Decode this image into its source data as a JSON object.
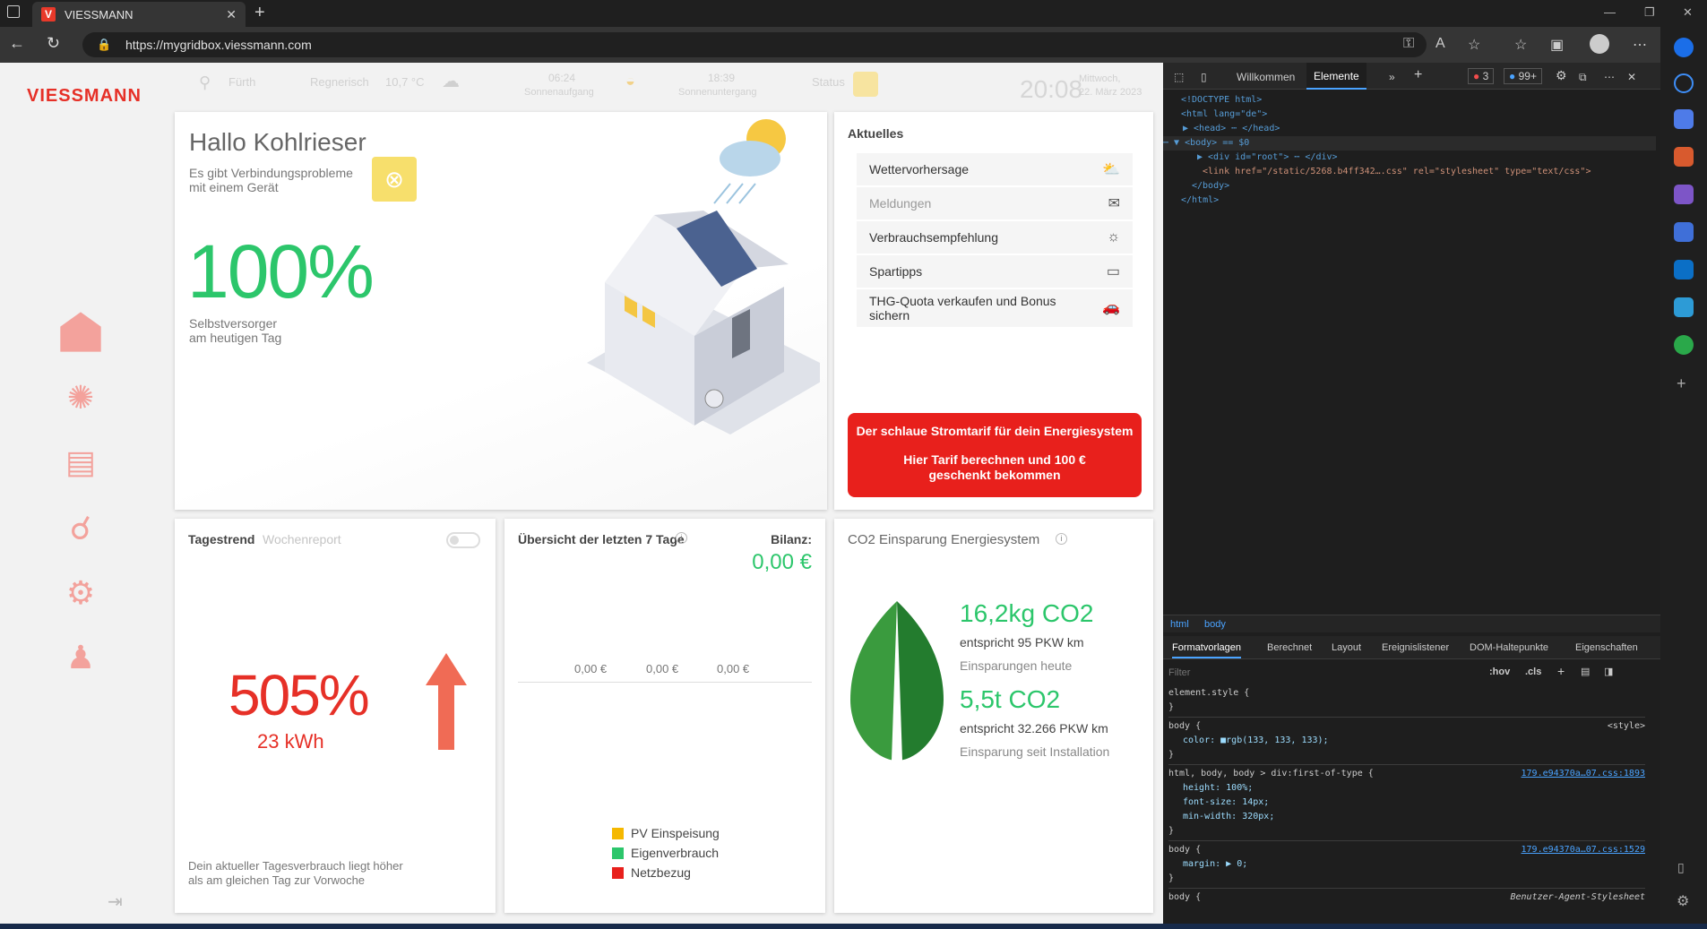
{
  "browser": {
    "tab_title": "VIESSMANN",
    "url": "https://mygridbox.viessmann.com"
  },
  "header": {
    "logo": "VIESSMANN",
    "location": "Fürth",
    "weather": "Regnerisch",
    "temperature": "10,7 °C",
    "sunrise_time": "06:24",
    "sunrise_label": "Sonnenaufgang",
    "sunset_time": "18:39",
    "sunset_label": "Sonnenuntergang",
    "status_label": "Status",
    "clock": "20:08",
    "date_line1": "Mittwoch,",
    "date_line2": "22. März 2023"
  },
  "hero": {
    "greeting": "Hallo Kohlrieser",
    "warning": "Es gibt Verbindungsprobleme mit einem Gerät",
    "percent": "100%",
    "percent_caption1": "Selbstversorger",
    "percent_caption2": "am heutigen Tag"
  },
  "aktuelles": {
    "title": "Aktuelles",
    "items": [
      {
        "label": "Wettervorhersage",
        "icon": "weather-icon"
      },
      {
        "label": "Meldungen",
        "icon": "mail-icon"
      },
      {
        "label": "Verbrauchsempfehlung",
        "icon": "bulb-icon"
      },
      {
        "label": "Spartipps",
        "icon": "money-icon"
      },
      {
        "label": "THG-Quota verkaufen und Bonus sichern",
        "icon": "car-icon"
      }
    ],
    "promo_line1": "Der schlaue Stromtarif für dein Energiesystem",
    "promo_line2": "Hier Tarif berechnen und 100 € geschenkt bekommen"
  },
  "trend": {
    "tab1": "Tagestrend",
    "tab2": "Wochenreport",
    "percent": "505%",
    "kwh": "23 kWh",
    "note": "Dein aktueller Tagesverbrauch liegt höher als am gleichen Tag zur Vorwoche"
  },
  "overview": {
    "title": "Übersicht der letzten 7 Tage",
    "bilanz_label": "Bilanz:",
    "bilanz_value": "0,00 €",
    "bar_values": [
      "0,00 €",
      "0,00 €",
      "0,00 €"
    ],
    "legend": [
      {
        "label": "PV Einspeisung",
        "color": "#f5b800"
      },
      {
        "label": "Eigenverbrauch",
        "color": "#2cc66b"
      },
      {
        "label": "Netzbezug",
        "color": "#e8201c"
      }
    ]
  },
  "co2": {
    "title": "CO2 Einsparung Energiesystem",
    "today_value": "16,2kg CO2",
    "today_equiv": "entspricht 95 PKW km",
    "today_label": "Einsparungen heute",
    "total_value": "5,5t CO2",
    "total_equiv": "entspricht 32.266 PKW km",
    "total_label": "Einsparung seit Installation"
  },
  "devtools": {
    "tabs": [
      "Willkommen",
      "Elemente"
    ],
    "errors": "3",
    "messages": "99+",
    "breadcrumb": [
      "html",
      "body"
    ],
    "subtabs": [
      "Formatvorlagen",
      "Berechnet",
      "Layout",
      "Ereignislistener",
      "DOM-Haltepunkte",
      "Eigenschaften"
    ],
    "filter_placeholder": "Filter",
    "hov": ":hov",
    "cls": ".cls",
    "dom": [
      "<!DOCTYPE html>",
      "<html lang=\"de\">",
      "▶ <head> ⋯ </head>",
      "⋯ ▼ <body> == $0",
      "▶ <div id=\"root\"> ⋯ </div>",
      "<link href=\"/static/5268.b4ff342….css\" rel=\"stylesheet\" type=\"text/css\">",
      "</body>",
      "</html>"
    ],
    "styles": [
      {
        "selector": "element.style {",
        "props": [],
        "source": ""
      },
      {
        "selector": "body {",
        "props": [
          "color: ■rgb(133, 133, 133);"
        ],
        "source": "<style>"
      },
      {
        "selector": "html, body, body > div:first-of-type {",
        "props": [
          "height: 100%;",
          "font-size: 14px;",
          "min-width: 320px;"
        ],
        "source": "179.e94370a…07.css:1893"
      },
      {
        "selector": "body {",
        "props": [
          "margin: ▶ 0;"
        ],
        "source": "179.e94370a…07.css:1529"
      },
      {
        "selector": "body {",
        "props": [],
        "source": "Benutzer-Agent-Stylesheet"
      }
    ]
  }
}
